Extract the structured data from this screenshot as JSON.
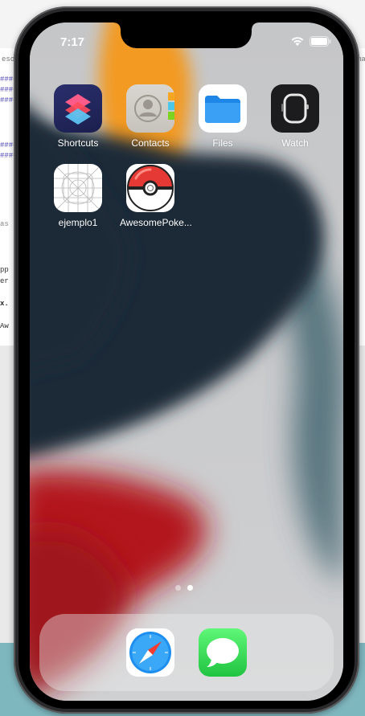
{
  "status_bar": {
    "time": "7:17"
  },
  "apps": [
    {
      "label": "Shortcuts",
      "icon": "shortcuts-icon"
    },
    {
      "label": "Contacts",
      "icon": "contacts-icon"
    },
    {
      "label": "Files",
      "icon": "files-icon"
    },
    {
      "label": "Watch",
      "icon": "watch-icon"
    },
    {
      "label": "ejemplo1",
      "icon": "app-placeholder-icon"
    },
    {
      "label": "AwesomePoke...",
      "icon": "pokeball-icon"
    }
  ],
  "dock": [
    {
      "label": "Safari",
      "icon": "safari-icon"
    },
    {
      "label": "Messages",
      "icon": "messages-icon"
    }
  ],
  "page_dots": {
    "count": 2,
    "active": 2
  },
  "desktop_text": [
    "####",
    "####",
    "####",
    "####",
    "####",
    "as",
    "pp",
    "er",
    "x.",
    "Aw",
    "eso",
    "ma"
  ],
  "colors": {
    "wallpaper_orange": "#f49a24",
    "wallpaper_navy": "#1b2a3a",
    "wallpaper_red": "#b3141d",
    "wallpaper_teal": "#3a5f6a",
    "files_blue": "#1f88e8",
    "messages_green": "#35c758"
  }
}
